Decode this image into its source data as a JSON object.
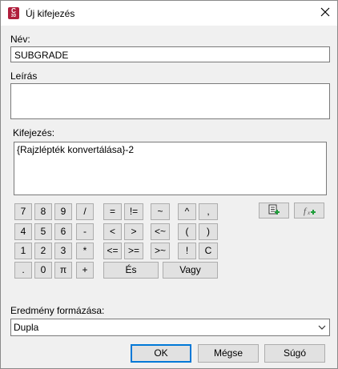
{
  "window": {
    "title": "Új kifejezés",
    "app_icon_text": "C",
    "app_icon_sub": "3D"
  },
  "name": {
    "label": "Név:",
    "value": "SUBGRADE"
  },
  "description": {
    "label": "Leírás",
    "value": ""
  },
  "expression": {
    "label": "Kifejezés:",
    "value": "{Rajzlépték konvertálása}-2"
  },
  "keypad": {
    "row1": [
      "7",
      "8",
      "9",
      "/",
      "=",
      "!=",
      "~",
      "^",
      ","
    ],
    "row2": [
      "4",
      "5",
      "6",
      "-",
      "<",
      ">",
      "<~",
      "(",
      ")"
    ],
    "row3": [
      "1",
      "2",
      "3",
      "*",
      "<=",
      ">=",
      ">~",
      "!",
      "C"
    ],
    "row4": [
      ".",
      "0",
      "π",
      "+"
    ],
    "and_label": "És",
    "or_label": "Vagy"
  },
  "format": {
    "label": "Eredmény formázása:",
    "selected": "Dupla"
  },
  "buttons": {
    "ok": "OK",
    "cancel": "Mégse",
    "help": "Súgó"
  },
  "colors": {
    "app_icon": "#b01e3c",
    "default_border": "#0078d7",
    "insert_icon_green": "#1e9e3a"
  }
}
